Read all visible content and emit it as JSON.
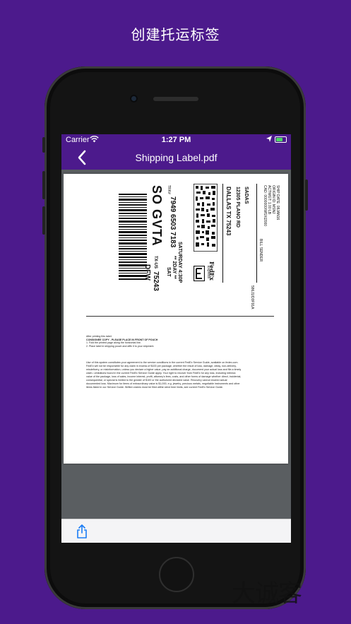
{
  "headline": "创建托运标签",
  "status_bar": {
    "carrier": "Carrier",
    "time": "1:27 PM"
  },
  "nav": {
    "title": "Shipping Label.pdf"
  },
  "label": {
    "route_code": "SO GVTA",
    "tracking": "7949 6503 7183",
    "tracking_prefix": "TRK#",
    "city": "DALLAS TX 75243",
    "street": "12305 PLANO RD",
    "company": "SADAS",
    "delivery_day": "SATURDAY 4:30P",
    "service": "** 2DAY **",
    "sat": "SAT",
    "sub_code": "75243",
    "dfw": "DFW",
    "zone": "TX-US",
    "ship_date": "SHIP DATE: 08JAN16",
    "origin": "ORIGIN ID: MSNJ",
    "weight": "ACTWGT: 1.00 LB",
    "cad": "CAD: 0000000/WSXI2000",
    "bill": "BILL SENDER",
    "fedex": "FedEx",
    "fedex_sub": "Express",
    "express_mark": "E",
    "ref": "586J1/D0F91A"
  },
  "instructions": {
    "line1": "After printing this label:",
    "line2": "CONSIGNEE COPY - PLEASE PLACE IN FRONT OF POUCH",
    "line3": "1. Fold the printed page along the horizontal line.",
    "line4": "2. Place label in shipping pouch and affix it to your shipment."
  },
  "terms": "Use of this system constitutes your agreement to the service conditions in the current FedEx Service Guide, available on fedex.com. FedEx will not be responsible for any claim in excess of $100 per package, whether the result of loss, damage, delay, non-delivery, misdelivery, or misinformation, unless you declare a higher value, pay an additional charge, document your actual loss and file a timely claim. Limitations found in the current FedEx Service Guide apply. Your right to recover from FedEx for any loss, including intrinsic value of the package, loss of sales, income interest, profit, attorney's fees, costs, and other forms of damage whether direct, incidental, consequential, or special is limited to the greater of $100 or the authorized declared value. Recovery cannot exceed actual documented loss. Maximum for items of extraordinary value is $1,000, e.g. jewelry, precious metals, negotiable instruments and other items listed in our Service Guide. Written claims must be filed within strict time limits, see current FedEx Service Guide.",
  "watermark": "大诚客",
  "colors": {
    "brand": "#4c1a8c",
    "battery": "#4cd964",
    "accent": "#1a7cf5"
  }
}
